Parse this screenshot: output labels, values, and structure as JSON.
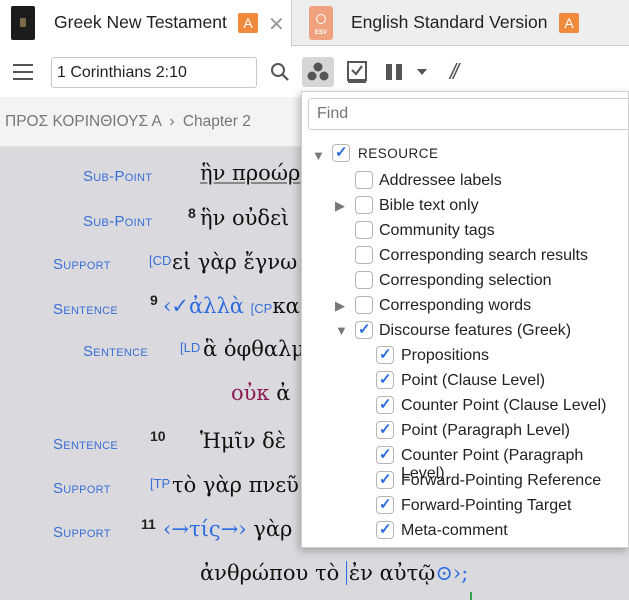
{
  "tabs": [
    {
      "title": "Greek New Testament",
      "badge": "A",
      "close": "✕",
      "thumb": "book-cover"
    },
    {
      "title": "English Standard Version",
      "badge": "A",
      "thumb_text": "ESV"
    }
  ],
  "toolbar": {
    "reference_value": "1 Corinthians 2:10"
  },
  "breadcrumb": {
    "book": "ΠΡΟΣ ΚΟΡΙΝΘΙΟΥΣ Α",
    "separator": "›",
    "chapter": "Chapter 2"
  },
  "content": {
    "rows": [
      {
        "label": "Sub-Point",
        "verse": "",
        "ann": "",
        "text": "ἣν προώρ"
      },
      {
        "label": "Sub-Point",
        "verse": "8",
        "ann": "",
        "text": "ἣν οὐδεὶ"
      },
      {
        "label": "Support",
        "verse": "",
        "ann": "[CD",
        "text": "εἰ γὰρ ἔγνω"
      },
      {
        "label": "Sentence",
        "verse": "9",
        "ann": "[CP",
        "text_pre": "‹✓ἀλλὰ ",
        "text": "κα"
      },
      {
        "label": "Sentence",
        "verse": "",
        "ann": "[LD",
        "text": "ἃ ὀφθαλμ"
      },
      {
        "label": "",
        "verse": "",
        "ann": "",
        "text_purple": "οὐκ",
        "text": " ἀ"
      },
      {
        "label": "Sentence",
        "verse": "10",
        "ann": "",
        "text": "Ἡμῖν δὲ"
      },
      {
        "label": "Support",
        "verse": "",
        "ann": "[TP",
        "text": "τὸ γὰρ πνεῦ"
      },
      {
        "label": "Support",
        "verse": "11",
        "ann": "",
        "text_pre": "‹→τίς→›",
        "text": " γὰρ"
      },
      {
        "label": "",
        "verse": "",
        "ann": "",
        "text": "ἀνθρώπου τὸ",
        "text2": "ἐν αὐτῷ",
        "text_post": "⊙›;"
      }
    ]
  },
  "panel": {
    "find_placeholder": "Find",
    "items": [
      {
        "label": "RESOURCE",
        "checked": true,
        "expander": "▼"
      },
      {
        "label": "Addressee labels",
        "checked": false,
        "expander": ""
      },
      {
        "label": "Bible text only",
        "checked": false,
        "expander": "▶"
      },
      {
        "label": "Community tags",
        "checked": false,
        "expander": ""
      },
      {
        "label": "Corresponding search results",
        "checked": false,
        "expander": ""
      },
      {
        "label": "Corresponding selection",
        "checked": false,
        "expander": ""
      },
      {
        "label": "Corresponding words",
        "checked": false,
        "expander": "▶"
      },
      {
        "label": "Discourse features (Greek)",
        "checked": true,
        "expander": "▼"
      },
      {
        "label": "Propositions",
        "checked": true,
        "expander": ""
      },
      {
        "label": "Point (Clause Level)",
        "checked": true,
        "expander": ""
      },
      {
        "label": "Counter Point (Clause Level)",
        "checked": true,
        "expander": ""
      },
      {
        "label": "Point (Paragraph Level)",
        "checked": true,
        "expander": ""
      },
      {
        "label": "Counter Point (Paragraph Level)",
        "checked": true,
        "expander": ""
      },
      {
        "label": "Forward-Pointing Reference",
        "checked": true,
        "expander": ""
      },
      {
        "label": "Forward-Pointing Target",
        "checked": true,
        "expander": ""
      },
      {
        "label": "Meta-comment",
        "checked": true,
        "expander": ""
      }
    ]
  },
  "colors": {
    "accent": "#2d6be0",
    "badge": "#f08a3c",
    "label_blue": "#3b6fd6",
    "purple": "#8b1b55"
  }
}
